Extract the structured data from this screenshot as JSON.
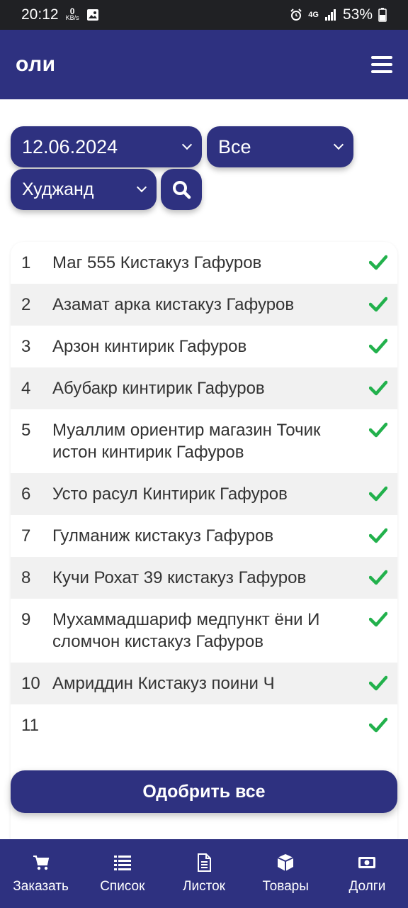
{
  "status_bar": {
    "time": "20:12",
    "kbs_value": "0",
    "kbs_unit": "KB/s",
    "network": "4G",
    "battery": "53%"
  },
  "header": {
    "title": "оли"
  },
  "filters": {
    "date": "12.06.2024",
    "status": "Все",
    "city": "Худжанд"
  },
  "items": [
    {
      "num": "1",
      "name": "Маг 555 Кистакуз Гафуров"
    },
    {
      "num": "2",
      "name": "Азамат арка кистакуз Гафуров"
    },
    {
      "num": "3",
      "name": "Арзон кинтирик Гафуров"
    },
    {
      "num": "4",
      "name": "Абубакр кинтирик Гафуров"
    },
    {
      "num": "5",
      "name": "Муаллим ориентир магазин Точикистон кинтирик Гафуров"
    },
    {
      "num": "6",
      "name": "Усто расул Кинтирик Гафуров"
    },
    {
      "num": "7",
      "name": "Гулманиж кистакуз Гафуров"
    },
    {
      "num": "8",
      "name": "Кучи Рохат 39 кистакуз Гафуров"
    },
    {
      "num": "9",
      "name": "Мухаммадшариф медпункт ёни Исломчон кистакуз Гафуров"
    },
    {
      "num": "10",
      "name": "Амриддин Кистакуз поини Ч"
    },
    {
      "num": "11",
      "name": ""
    }
  ],
  "approve_label": "Одобрить все",
  "nav": [
    {
      "label": "Заказать",
      "icon": "cart-icon"
    },
    {
      "label": "Список",
      "icon": "list-icon"
    },
    {
      "label": "Листок",
      "icon": "document-icon"
    },
    {
      "label": "Товары",
      "icon": "box-icon"
    },
    {
      "label": "Долги",
      "icon": "money-icon"
    }
  ],
  "colors": {
    "primary": "#2e3180",
    "check": "#22b14c",
    "row_alt": "#f1f1f1"
  }
}
